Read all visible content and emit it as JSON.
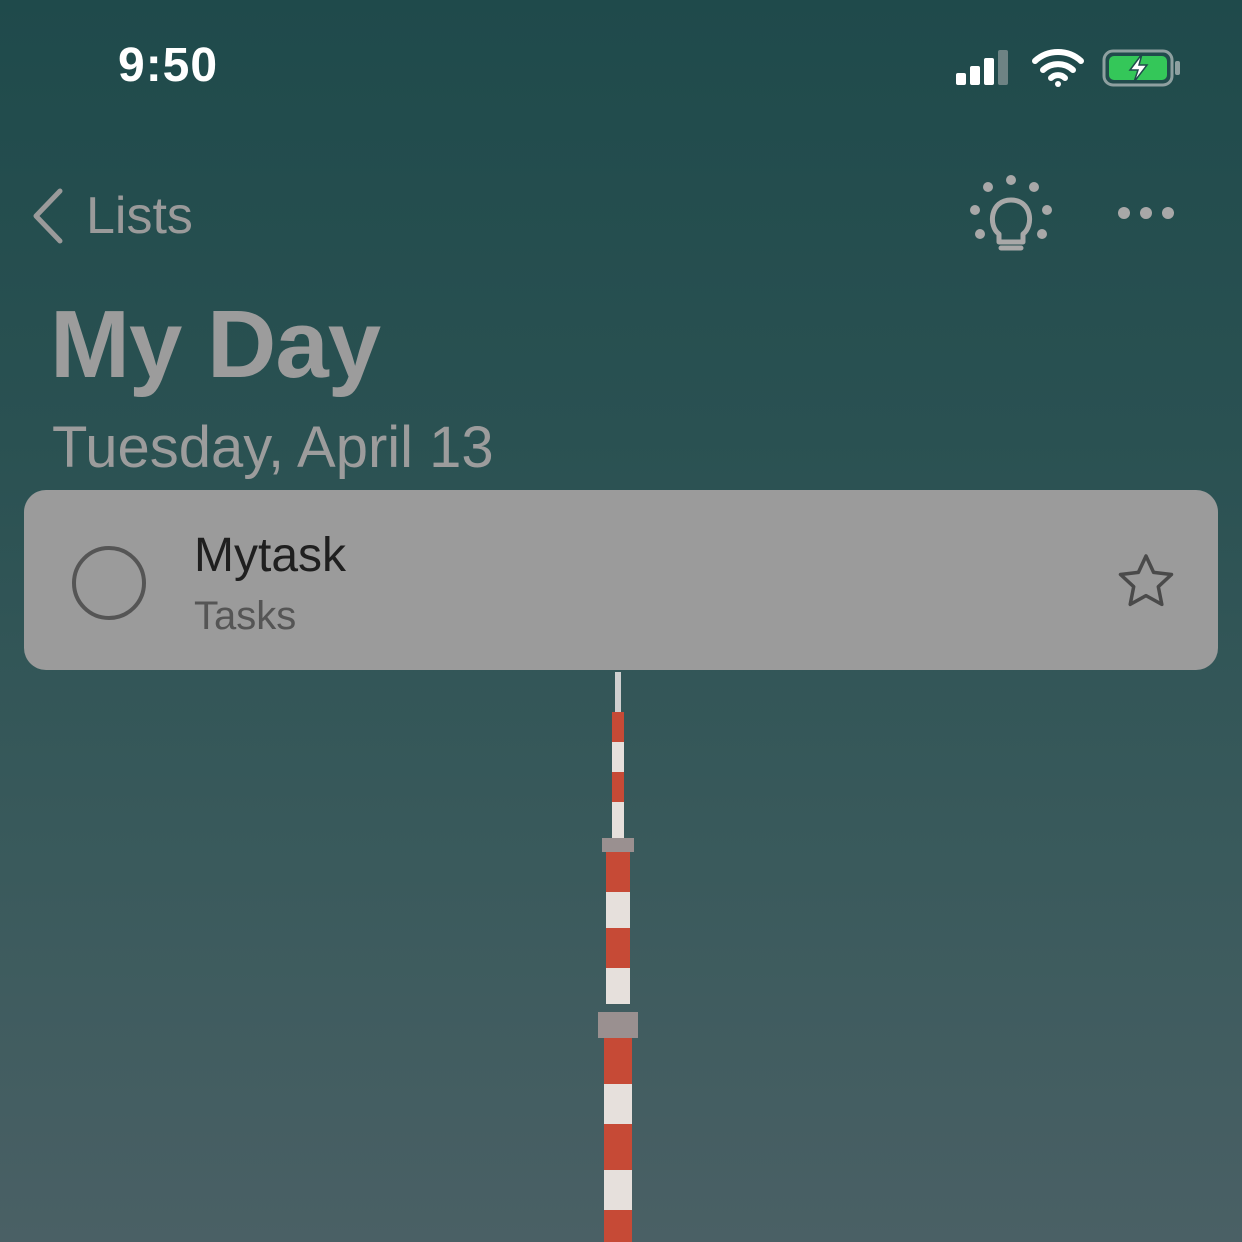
{
  "status_bar": {
    "time": "9:50",
    "icons": [
      "cellular-signal-icon",
      "wifi-icon",
      "battery-charging-icon"
    ],
    "battery_color": "#34c759"
  },
  "nav": {
    "back_label": "Lists",
    "icons": [
      "chevron-left-icon",
      "lightbulb-icon",
      "more-icon"
    ]
  },
  "header": {
    "title": "My Day",
    "date": "Tuesday, April 13"
  },
  "tasks": [
    {
      "title": "Mytask",
      "list": "Tasks",
      "completed": false,
      "important": false
    }
  ],
  "colors": {
    "background": "#2a5152",
    "header_text": "#9c9c9c",
    "card": "#9b9b9b"
  }
}
